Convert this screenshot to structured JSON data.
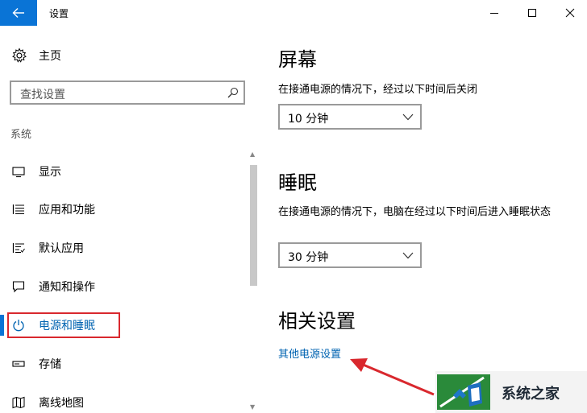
{
  "window": {
    "title": "设置"
  },
  "nav": {
    "home": "主页",
    "search_placeholder": "查找设置",
    "group": "系统",
    "items": [
      {
        "label": "显示",
        "icon": "monitor-icon"
      },
      {
        "label": "应用和功能",
        "icon": "list-icon"
      },
      {
        "label": "默认应用",
        "icon": "list-check-icon"
      },
      {
        "label": "通知和操作",
        "icon": "speech-bubble-icon"
      },
      {
        "label": "电源和睡眠",
        "icon": "power-icon",
        "active": true
      },
      {
        "label": "存储",
        "icon": "drive-icon"
      },
      {
        "label": "离线地图",
        "icon": "map-icon"
      }
    ]
  },
  "main": {
    "screen": {
      "title": "屏幕",
      "desc": "在接通电源的情况下，经过以下时间后关闭",
      "value": "10 分钟"
    },
    "sleep": {
      "title": "睡眠",
      "desc": "在接通电源的情况下，电脑在经过以下时间后进入睡眠状态",
      "value": "30 分钟"
    },
    "related": {
      "title": "相关设置",
      "link": "其他电源设置"
    }
  },
  "watermark": {
    "text": "系统之家"
  },
  "colors": {
    "accent": "#0a74d6",
    "link": "#0063b1",
    "highlight": "#d9282e"
  }
}
